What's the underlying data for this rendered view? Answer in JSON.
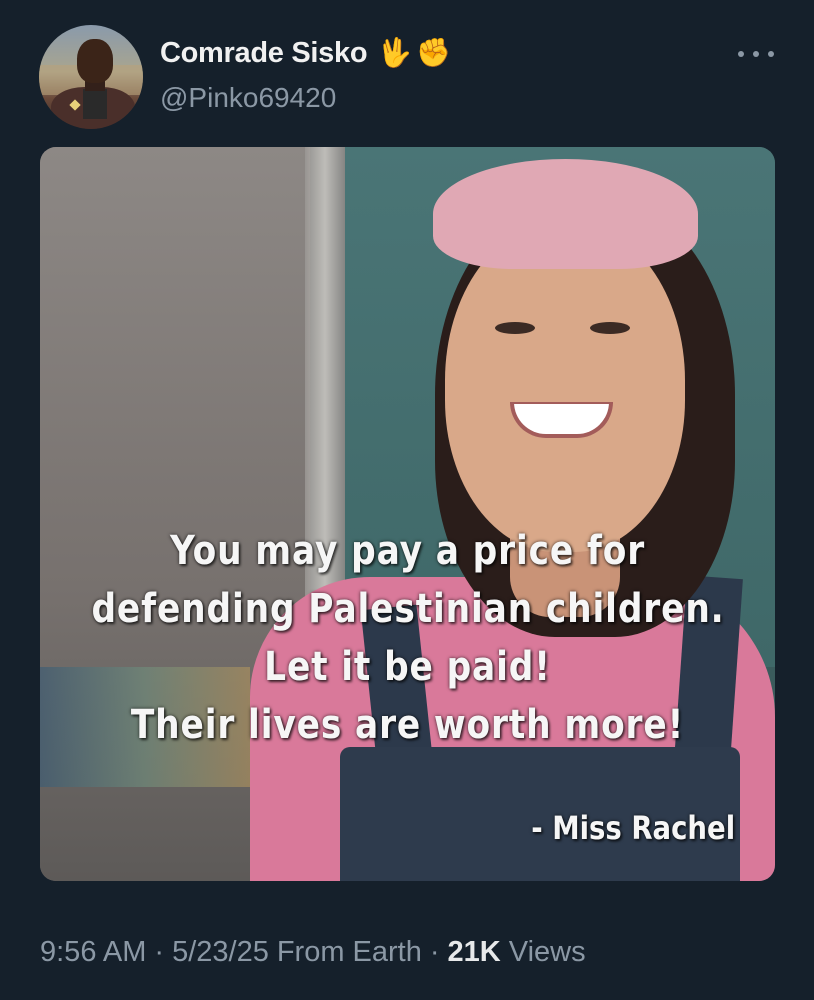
{
  "author": {
    "display_name": "Comrade Sisko",
    "handle": "@Pinko69420",
    "badges": [
      "vulcan-salute-emoji",
      "raised-fist-emoji"
    ],
    "badge_glyphs": [
      "🖖",
      "✊"
    ]
  },
  "media": {
    "caption_lines": [
      "You may pay a price for",
      "defending Palestinian children.",
      "Let it be paid!",
      "Their lives are worth more!"
    ],
    "attribution": "- Miss Rachel"
  },
  "meta": {
    "time": "9:56 AM",
    "separator": "·",
    "date": "5/23/25",
    "source": "From Earth",
    "views_count": "21K",
    "views_label": "Views"
  },
  "colors": {
    "background": "#15202b",
    "primary_text": "#e7e9ea",
    "secondary_text": "#8b98a5"
  }
}
